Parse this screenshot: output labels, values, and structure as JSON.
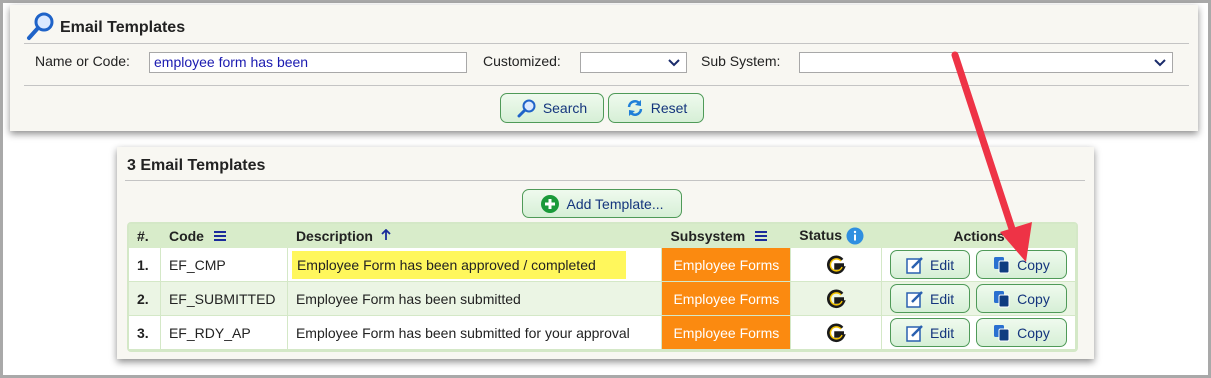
{
  "search": {
    "title": "Email Templates",
    "name_label": "Name or Code:",
    "name_value": "employee form has been",
    "customized_label": "Customized:",
    "customized_value": "",
    "subsystem_label": "Sub System:",
    "subsystem_value": "",
    "search_button": "Search",
    "reset_button": "Reset"
  },
  "results": {
    "title": "3 Email Templates",
    "add_button": "Add Template...",
    "columns": {
      "num": "#.",
      "code": "Code",
      "description": "Description",
      "subsystem": "Subsystem",
      "status": "Status",
      "actions": "Actions"
    },
    "rows": [
      {
        "num": "1.",
        "code": "EF_CMP",
        "description": "Employee Form has been approved / completed",
        "subsystem": "Employee Forms",
        "edit": "Edit",
        "copy": "Copy"
      },
      {
        "num": "2.",
        "code": "EF_SUBMITTED",
        "description": "Employee Form has been submitted",
        "subsystem": "Employee Forms",
        "edit": "Edit",
        "copy": "Copy"
      },
      {
        "num": "3.",
        "code": "EF_RDY_AP",
        "description": "Employee Form has been submitted for your approval",
        "subsystem": "Employee Forms",
        "edit": "Edit",
        "copy": "Copy"
      }
    ]
  },
  "colors": {
    "subsystem_bg": "#fb8a10",
    "highlight": "#fff75c",
    "button_border": "#4f9a58",
    "annotation_arrow": "#ee3346"
  },
  "icons": {
    "title": "magnifier-icon",
    "search": "search-icon",
    "reset": "refresh-icon",
    "add": "plus-circle-icon",
    "sort_menu": "menu-icon",
    "sort_asc": "arrow-up-icon",
    "info": "info-icon",
    "status": "g-logo-icon",
    "edit": "edit-icon",
    "copy": "copy-icon"
  }
}
